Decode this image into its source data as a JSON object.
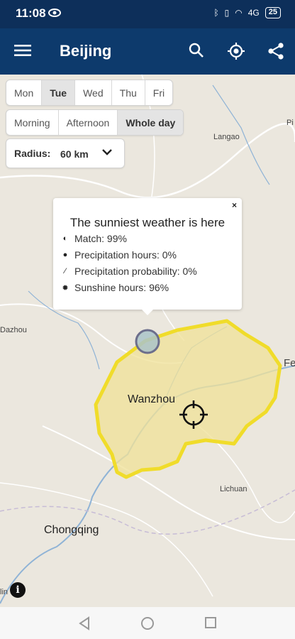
{
  "status": {
    "time": "11:08",
    "battery": "25",
    "network": "4G"
  },
  "appbar": {
    "title": "Beijing",
    "menu_icon": "menu-icon",
    "search_icon": "search-icon",
    "locate_icon": "gps-locate-icon",
    "share_icon": "share-icon"
  },
  "days": {
    "options": [
      "Mon",
      "Tue",
      "Wed",
      "Thu",
      "Fri"
    ],
    "selected": "Tue"
  },
  "periods": {
    "options": [
      "Morning",
      "Afternoon",
      "Whole day"
    ],
    "selected": "Whole day"
  },
  "radius": {
    "label": "Radius:",
    "value": "60 km"
  },
  "popup": {
    "title": "The sunniest weather is here",
    "close": "×",
    "rows": [
      {
        "icon": "match-icon",
        "text": "Match: 99%"
      },
      {
        "icon": "drop-icon",
        "text": "Precipitation hours: 0%"
      },
      {
        "icon": "rain-icon",
        "text": "Precipitation probability: 0%"
      },
      {
        "icon": "sun-icon",
        "text": "Sunshine hours: 96%"
      }
    ]
  },
  "map": {
    "labels": {
      "wanzhou": "Wanzhou",
      "chongqing": "Chongqing",
      "dazhou": "Dazhou",
      "langao": "Langao",
      "lichuan": "Lichuan",
      "fe": "Fe",
      "pi": "Pi",
      "lin": "lin"
    },
    "area_color": "#f0dc2a",
    "area_fill": "#efe29a"
  },
  "info_label": "i"
}
